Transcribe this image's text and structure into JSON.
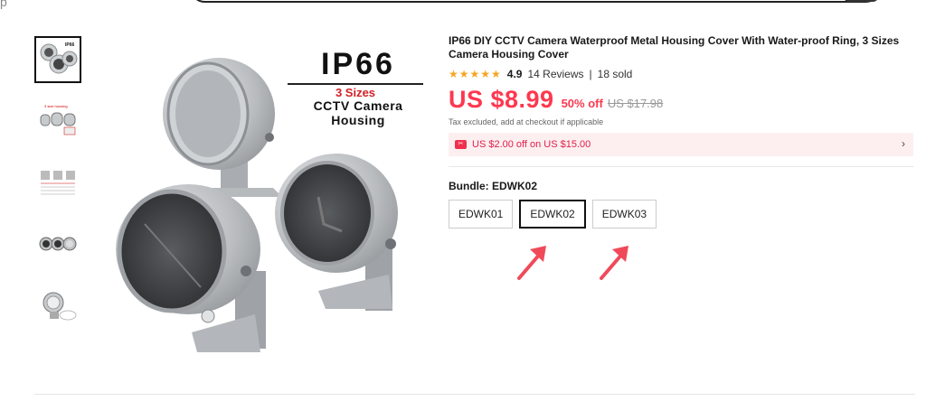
{
  "header": {
    "logo_fragment": "p"
  },
  "gallery": {
    "thumbnails": [
      {
        "name": "thumb-1",
        "active": true
      },
      {
        "name": "thumb-2",
        "active": false
      },
      {
        "name": "thumb-3",
        "active": false
      },
      {
        "name": "thumb-4",
        "active": false
      },
      {
        "name": "thumb-5",
        "active": false
      }
    ],
    "hero_title": "IP66",
    "hero_sizes": "3 Sizes",
    "hero_subtitle": "CCTV Camera Housing"
  },
  "product": {
    "title": "IP66 DIY CCTV Camera Waterproof Metal Housing Cover With Water-proof Ring, 3 Sizes Camera Housing Cover",
    "stars": "★★★★★",
    "rating": "4.9",
    "reviews": "14 Reviews",
    "separator": "|",
    "sold": "18 sold",
    "price": "US $8.99",
    "discount": "50% off",
    "original_price": "US $17.98",
    "tax_note": "Tax excluded, add at checkout if applicable",
    "coupon_text": "US $2.00 off on US $15.00",
    "coupon_icon_glyph": "✂",
    "chevron": "›",
    "bundle_label": "Bundle: EDWK02",
    "options": [
      "EDWK01",
      "EDWK02",
      "EDWK03"
    ],
    "selected_option": "EDWK02"
  },
  "colors": {
    "price": "#fd384f",
    "coupon_bg": "#fdeff0",
    "annotation_arrow": "#f04a5a",
    "star": "#f5a623"
  }
}
